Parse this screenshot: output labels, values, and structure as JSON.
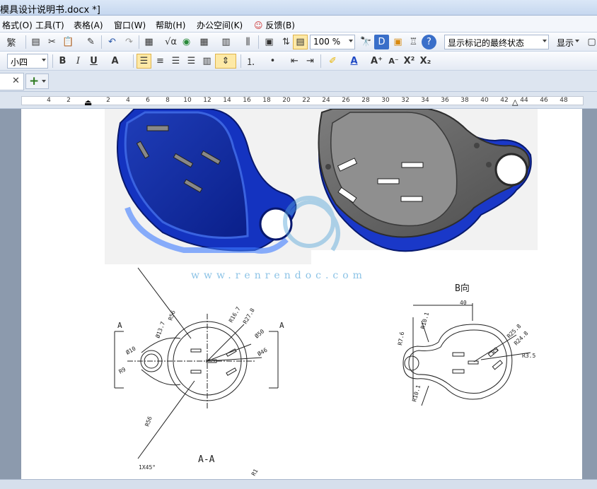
{
  "window": {
    "title": "模具设计说明书.docx *]"
  },
  "menubar": {
    "items": [
      "格式(O)",
      "工具(T)",
      "表格(A)",
      "窗口(W)",
      "帮助(H)",
      "办公空间(K)",
      "反馈(B)"
    ]
  },
  "toolbar1": {
    "trad_label": "繁",
    "zoom_value": "100 %",
    "markup_state": "显示标记的最终状态",
    "show_label": "显示"
  },
  "toolbar2": {
    "font_size": "小四"
  },
  "ruler": {
    "ticks": [
      "4",
      "2",
      "2",
      "4",
      "6",
      "8",
      "10",
      "12",
      "14",
      "16",
      "18",
      "20",
      "22",
      "24",
      "26",
      "28",
      "30",
      "32",
      "34",
      "36",
      "38",
      "40",
      "42",
      "44",
      "46",
      "48"
    ]
  },
  "document": {
    "watermark": "www.renrendoc.com",
    "drawing": {
      "view_label_b": "B向",
      "section_label": "A-A",
      "section_marks": [
        "A",
        "A"
      ],
      "dims_left": [
        "R56",
        "Ø13.7",
        "R16.7",
        "R27.8",
        "Ø50",
        "Ø46",
        "Ø10",
        "R9",
        "R56"
      ],
      "dims_right": [
        "40",
        "R10.1",
        "R25.8",
        "R24.8",
        "R3.5",
        "R7.6",
        "R5",
        "R10.1"
      ],
      "chamfer": "1X45°",
      "r1": "R1"
    }
  },
  "icons": [
    "new-doc-icon",
    "cut-icon",
    "paste-icon",
    "format-painter-icon",
    "undo-icon",
    "redo-icon",
    "insert-table-icon",
    "formula-icon",
    "web-icon",
    "table-grid-icon",
    "columns-icon",
    "chart-icon",
    "print-preview-icon",
    "zoom-fit-icon",
    "find-icon",
    "d-icon",
    "plugin-icon",
    "shirt-icon",
    "help-icon",
    "bold-icon",
    "italic-icon",
    "underline-icon",
    "align-left-icon",
    "align-center-icon",
    "align-right-icon",
    "justify-icon",
    "distribute-icon",
    "line-spacing-icon",
    "numbering-icon",
    "bullets-icon",
    "indent-decrease-icon",
    "indent-increase-icon",
    "highlight-icon",
    "font-color-icon",
    "grow-font-icon",
    "shrink-font-icon",
    "superscript-icon",
    "subscript-icon",
    "close-tab-icon",
    "new-tab-icon"
  ]
}
